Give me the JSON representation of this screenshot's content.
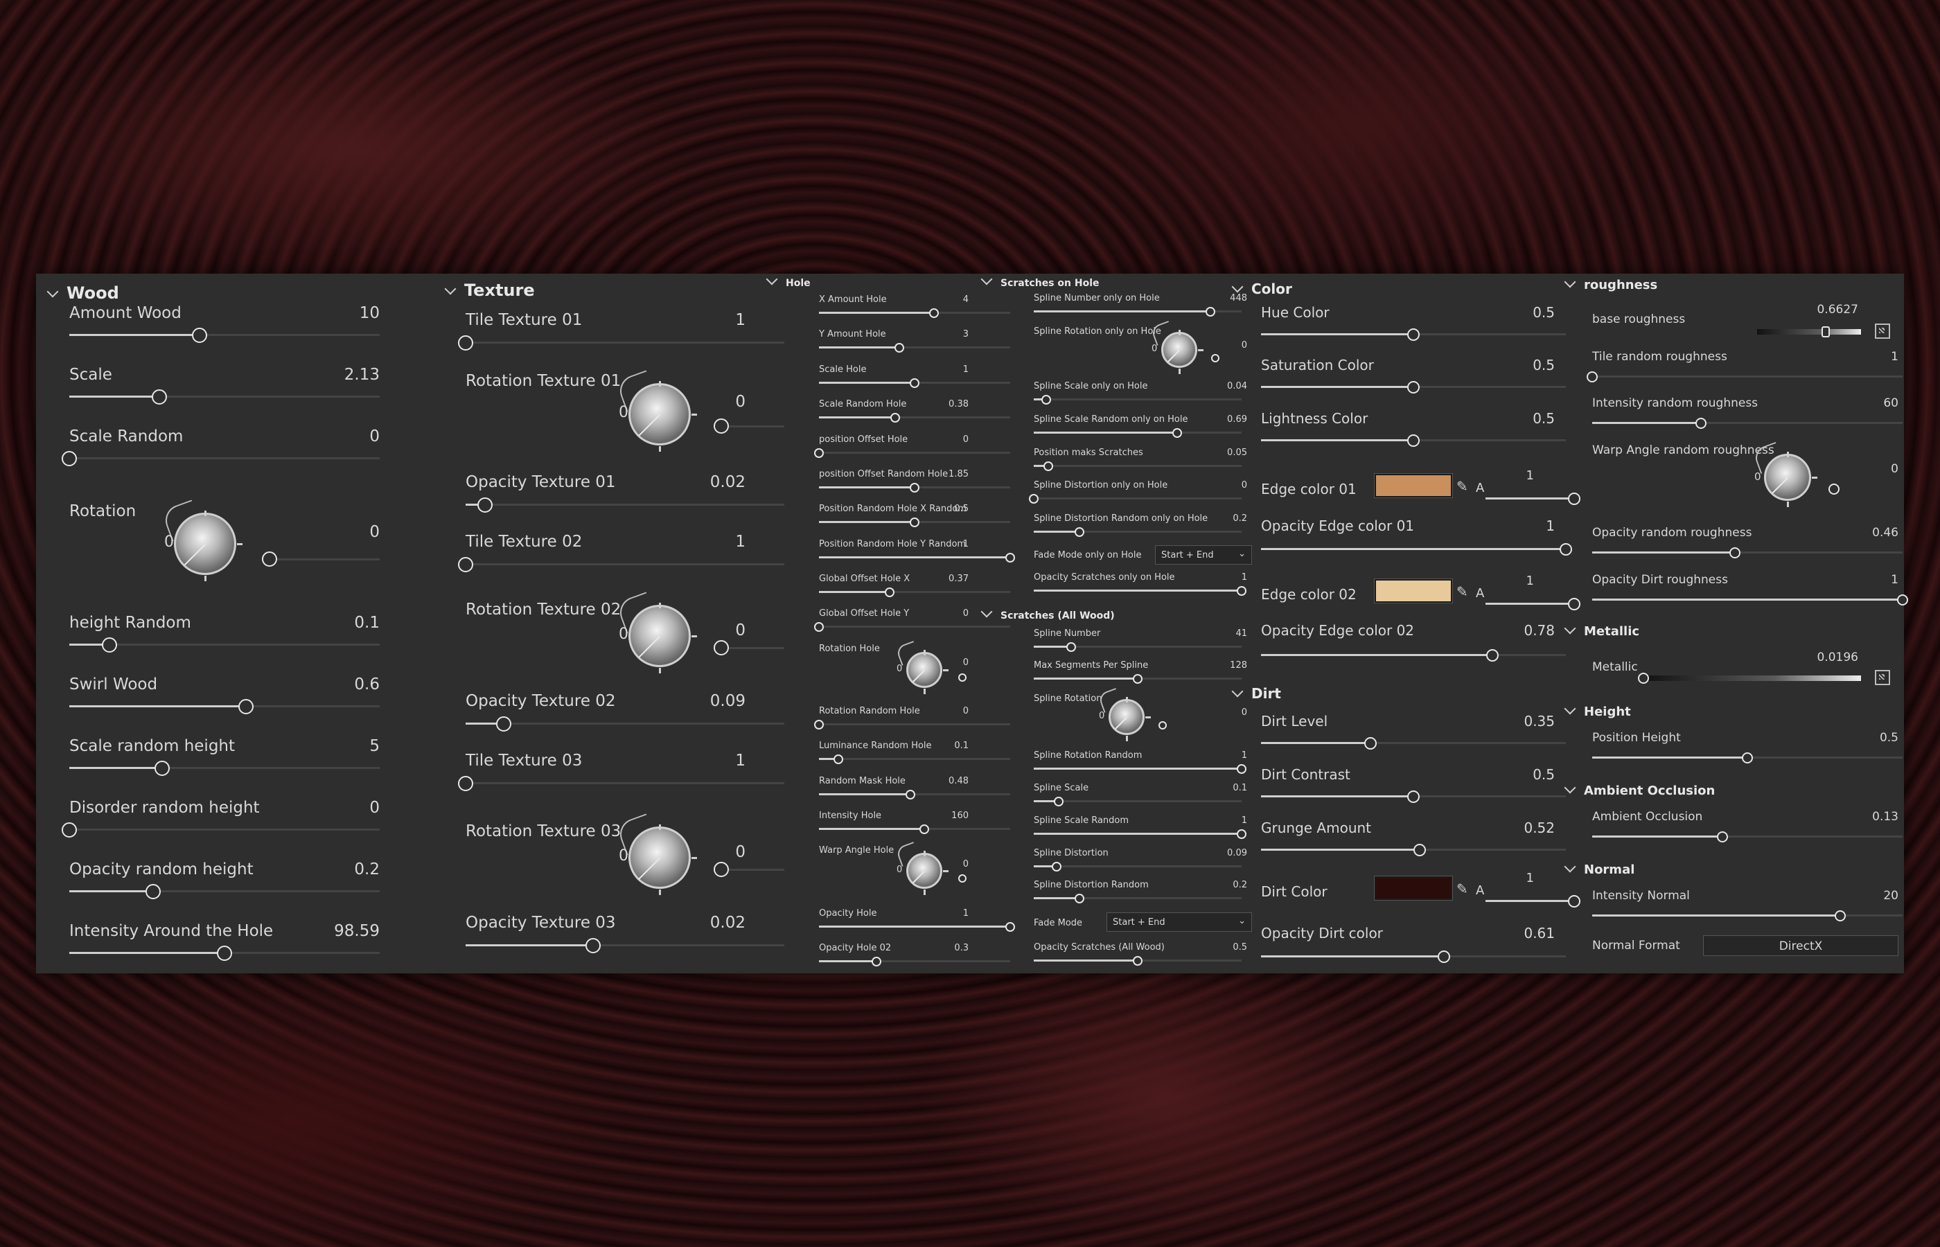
{
  "wood": {
    "title": "Wood",
    "items": [
      {
        "label": "Amount Wood",
        "value": "10",
        "fraction": 0.42
      },
      {
        "label": "Scale",
        "value": "2.13",
        "fraction": 0.29
      },
      {
        "label": "Scale Random",
        "value": "0",
        "fraction": 0.0
      },
      {
        "label": "Rotation",
        "value": "0",
        "knob_zero": "0"
      },
      {
        "label": "height Random",
        "value": "0.1",
        "fraction": 0.13
      },
      {
        "label": "Swirl Wood",
        "value": "0.6",
        "fraction": 0.57
      },
      {
        "label": "Scale random height",
        "value": "5",
        "fraction": 0.3
      },
      {
        "label": "Disorder random height",
        "value": "0",
        "fraction": 0.0
      },
      {
        "label": "Opacity random height",
        "value": "0.2",
        "fraction": 0.27
      },
      {
        "label": "Intensity Around the Hole",
        "value": "98.59",
        "fraction": 0.5
      }
    ]
  },
  "texture": {
    "title": "Texture",
    "items": [
      {
        "label": "Tile Texture 01",
        "value": "1",
        "fraction": 0.0
      },
      {
        "label": "Rotation Texture 01",
        "value": "0",
        "knob_zero": "0"
      },
      {
        "label": "Opacity Texture 01",
        "value": "0.02",
        "fraction": 0.06
      },
      {
        "label": "Tile Texture 02",
        "value": "1",
        "fraction": 0.0
      },
      {
        "label": "Rotation Texture 02",
        "value": "0",
        "knob_zero": "0"
      },
      {
        "label": "Opacity Texture 02",
        "value": "0.09",
        "fraction": 0.12
      },
      {
        "label": "Tile Texture 03",
        "value": "1",
        "fraction": 0.0
      },
      {
        "label": "Rotation Texture 03",
        "value": "0",
        "knob_zero": "0"
      },
      {
        "label": "Opacity Texture 03",
        "value": "0.02",
        "fraction": 0.4
      }
    ]
  },
  "hole": {
    "title": "Hole",
    "items": [
      {
        "label": "X Amount Hole",
        "value": "4",
        "fraction": 0.6
      },
      {
        "label": "Y Amount Hole",
        "value": "3",
        "fraction": 0.42
      },
      {
        "label": "Scale Hole",
        "value": "1",
        "fraction": 0.5
      },
      {
        "label": "Scale Random Hole",
        "value": "0.38",
        "fraction": 0.4
      },
      {
        "label": "position Offset Hole",
        "value": "0",
        "fraction": 0.0
      },
      {
        "label": "position Offset Random Hole",
        "value": "1.85",
        "fraction": 0.5
      },
      {
        "label": "Position Random Hole X Random",
        "value": "0.5",
        "fraction": 0.5
      },
      {
        "label": "Position Random Hole Y Random",
        "value": "1",
        "fraction": 1.0
      },
      {
        "label": "Global Offset Hole X",
        "value": "0.37",
        "fraction": 0.37
      },
      {
        "label": "Global Offset Hole Y",
        "value": "0",
        "fraction": 0.0
      },
      {
        "label": "Rotation Hole",
        "value": "0",
        "knob_zero": "0"
      },
      {
        "label": "Rotation Random Hole",
        "value": "0",
        "fraction": 0.0
      },
      {
        "label": "Luminance Random Hole",
        "value": "0.1",
        "fraction": 0.1
      },
      {
        "label": "Random Mask Hole",
        "value": "0.48",
        "fraction": 0.48
      },
      {
        "label": "Intensity Hole",
        "value": "160",
        "fraction": 0.55
      },
      {
        "label": "Warp Angle Hole",
        "value": "0",
        "knob_zero": "0"
      },
      {
        "label": "Opacity Hole",
        "value": "1",
        "fraction": 1.0
      },
      {
        "label": "Opacity Hole 02",
        "value": "0.3",
        "fraction": 0.3
      }
    ]
  },
  "scratches_hole": {
    "title": "Scratches on Hole",
    "items": [
      {
        "label": "Spline Number only on Hole",
        "value": "448",
        "fraction": 0.85
      },
      {
        "label": "Spline Rotation only on Hole",
        "value": "0",
        "knob_zero": "0"
      },
      {
        "label": "Spline Scale only on Hole",
        "value": "0.04",
        "fraction": 0.06
      },
      {
        "label": "Spline Scale Random only on Hole",
        "value": "0.69",
        "fraction": 0.69
      },
      {
        "label": "Position maks Scratches",
        "value": "0.05",
        "fraction": 0.07
      },
      {
        "label": "Spline Distortion only on Hole",
        "value": "0",
        "fraction": 0.0
      },
      {
        "label": "Spline Distortion Random only on Hole",
        "value": "0.2",
        "fraction": 0.22
      },
      {
        "label": "Fade Mode only on Hole",
        "dropdown": "Start + End"
      },
      {
        "label": "Opacity Scratches only on Hole",
        "value": "1",
        "fraction": 1.0
      }
    ]
  },
  "scratches_all": {
    "title": "Scratches (All Wood)",
    "items": [
      {
        "label": "Spline Number",
        "value": "41",
        "fraction": 0.18
      },
      {
        "label": "Max Segments Per Spline",
        "value": "128",
        "fraction": 0.5
      },
      {
        "label": "Spline Rotation",
        "value": "0",
        "knob_zero": "0"
      },
      {
        "label": "Spline Rotation Random",
        "value": "1",
        "fraction": 1.0
      },
      {
        "label": "Spline Scale",
        "value": "0.1",
        "fraction": 0.12
      },
      {
        "label": "Spline Scale Random",
        "value": "1",
        "fraction": 1.0
      },
      {
        "label": "Spline Distortion",
        "value": "0.09",
        "fraction": 0.11
      },
      {
        "label": "Spline Distortion Random",
        "value": "0.2",
        "fraction": 0.22
      },
      {
        "label": "Fade Mode",
        "dropdown": "Start + End"
      },
      {
        "label": "Opacity Scratches (All Wood)",
        "value": "0.5",
        "fraction": 0.5
      }
    ]
  },
  "color": {
    "title": "Color",
    "items": [
      {
        "label": "Hue Color",
        "value": "0.5",
        "fraction": 0.5
      },
      {
        "label": "Saturation Color",
        "value": "0.5",
        "fraction": 0.5
      },
      {
        "label": "Lightness Color",
        "value": "0.5",
        "fraction": 0.5
      }
    ],
    "edge1": {
      "label": "Edge color 01",
      "alpha_label": "A",
      "value": "1",
      "color": "#c98f5c",
      "fraction": 1.0
    },
    "opacity_edge1": {
      "label": "Opacity Edge color 01",
      "value": "1",
      "fraction": 1.0
    },
    "edge2": {
      "label": "Edge color 02",
      "alpha_label": "A",
      "value": "1",
      "color": "#e8c99a",
      "fraction": 1.0
    },
    "opacity_edge2": {
      "label": "Opacity Edge color 02",
      "value": "0.78",
      "fraction": 0.76
    }
  },
  "dirt": {
    "title": "Dirt",
    "items": [
      {
        "label": "Dirt Level",
        "value": "0.35",
        "fraction": 0.36
      },
      {
        "label": "Dirt Contrast",
        "value": "0.5",
        "fraction": 0.5
      },
      {
        "label": "Grunge Amount",
        "value": "0.52",
        "fraction": 0.52
      }
    ],
    "dirt_color": {
      "label": "Dirt Color",
      "alpha_label": "A",
      "value": "1",
      "color": "#2a0d0b",
      "fraction": 1.0
    },
    "opacity_dirt": {
      "label": "Opacity Dirt color",
      "value": "0.61",
      "fraction": 0.6
    }
  },
  "roughness": {
    "title": "roughness",
    "base": {
      "label": "base roughness",
      "value": "0.6627",
      "fraction": 0.66
    },
    "items": [
      {
        "label": "Tile random roughness",
        "value": "1",
        "fraction": 0.0
      },
      {
        "label": "Intensity random roughness",
        "value": "60",
        "fraction": 0.35
      }
    ],
    "warp": {
      "label": "Warp Angle  random roughness",
      "value": "0",
      "knob_zero": "0"
    },
    "items2": [
      {
        "label": "Opacity random roughness",
        "value": "0.46",
        "fraction": 0.46
      },
      {
        "label": "Opacity Dirt roughness",
        "value": "1",
        "fraction": 1.0
      }
    ]
  },
  "metallic": {
    "title": "Metallic",
    "label": "Metallic",
    "value": "0.0196",
    "fraction": 0.0
  },
  "height": {
    "title": "Height",
    "label": "Position Height",
    "value": "0.5",
    "fraction": 0.5
  },
  "ao": {
    "title": "Ambient Occlusion",
    "label": "Ambient Occlusion",
    "value": "0.13",
    "fraction": 0.42
  },
  "normal": {
    "title": "Normal",
    "label": "Intensity Normal",
    "value": "20",
    "fraction": 0.8,
    "format_label": "Normal Format",
    "format_value": "DirectX"
  }
}
